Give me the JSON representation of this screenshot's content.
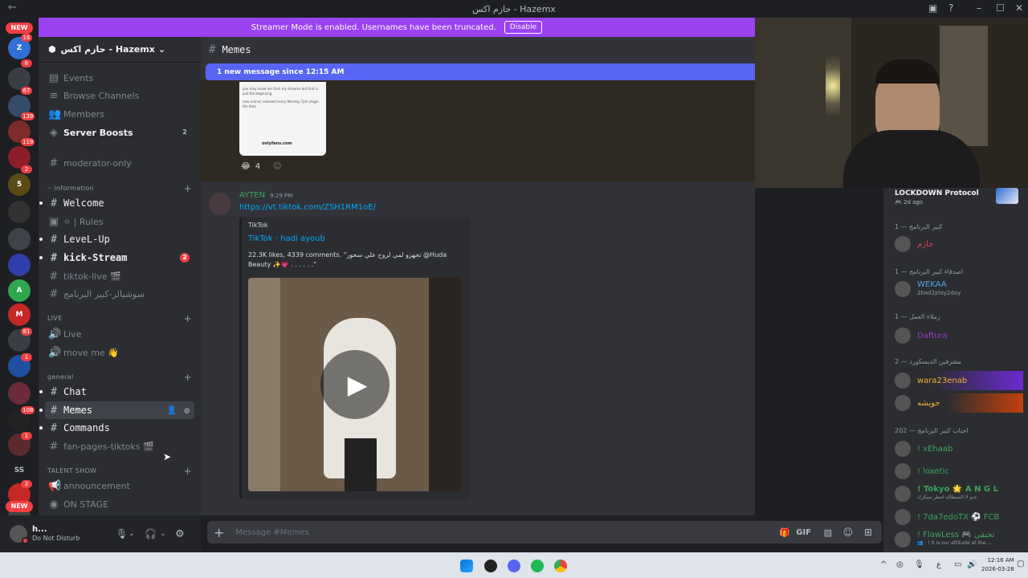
{
  "window": {
    "title": "حازم اكس - Hazemx",
    "controls": [
      "–",
      "☐",
      "✕"
    ]
  },
  "streamer_banner": {
    "text": "Streamer Mode is enabled. Usernames have been truncated.",
    "button": "Disable"
  },
  "guild_bar": {
    "new_top": "NEW",
    "new_bottom": "NEW",
    "badges": [
      "16",
      "6",
      "67",
      "139",
      "119",
      "2",
      "81",
      "1",
      "108",
      "1",
      "2",
      "1"
    ],
    "text_icon": "SS"
  },
  "server": {
    "name": "حازم اكس - Hazemx",
    "chevron": "⌄"
  },
  "sidebar": {
    "top_items": [
      {
        "label": "Events"
      },
      {
        "label": "Browse Channels"
      },
      {
        "label": "Members"
      },
      {
        "label": "Server Boosts",
        "badge": "2"
      }
    ],
    "moderator": "moderator-only",
    "cat_information": "·· information",
    "info_channels": [
      {
        "label": "Welcome"
      },
      {
        "label": "⚪ | Rules"
      },
      {
        "label": "LeveL-Up"
      },
      {
        "label": "kick-Stream",
        "badge": "2"
      },
      {
        "label": "tiktok-live 🎬"
      },
      {
        "label": "سوشيالز-كبير البرنامج"
      }
    ],
    "cat_live": "LIVE",
    "live_channels": [
      {
        "label": "Live"
      },
      {
        "label": "move me 👋"
      }
    ],
    "cat_general": "general",
    "general_channels": [
      {
        "label": "Chat"
      },
      {
        "label": "Memes"
      },
      {
        "label": "Commands"
      },
      {
        "label": "fan-pages-tiktoks 🎬"
      }
    ],
    "cat_talent": "TALENT SHOW",
    "talent_channels": [
      {
        "label": "announcement"
      },
      {
        "label": "ON STAGE"
      }
    ]
  },
  "user_panel": {
    "name": "h...",
    "status": "Do Not Disturb"
  },
  "chat": {
    "channel": "Memes",
    "new_messages": "1 new message since 12:15 AM",
    "meme_lines": [
      "you may know me from my streams but that is",
      "just the beginning",
      "new scenes released every Monday 7pm stage-",
      "the time"
    ],
    "meme_link": "onlyfans.com",
    "reaction_count": "4",
    "message": {
      "author": "AYTEN",
      "time": "9:29 PM",
      "link": "https://vt.tiktok.com/ZSH1RM1oE/",
      "embed_provider": "TikTok",
      "embed_title": "TikTok · hadi ayoub",
      "embed_desc": "22.3K likes, 4339 comments. \"تجهزو لمي لروح علي سحور @Huda Beauty ✨💗 . . . . . .\""
    },
    "input_placeholder": "Message #Memes"
  },
  "members": {
    "stream_card": {
      "title": "LOCKDOWN Protocol",
      "sub": "🎮 2d ago"
    },
    "groups": [
      {
        "label": "كبير البرنامج — 1",
        "users": [
          {
            "name": "حازم",
            "color": "#e0475b"
          }
        ]
      },
      {
        "label": "اصدقاء كبير البرنامج — 1",
        "users": [
          {
            "name": "WEKAA",
            "sub": "2bad2play2day",
            "color": "#4fa3e0"
          }
        ]
      },
      {
        "label": "زملاء العمل — 1",
        "users": [
          {
            "name": "Daftura",
            "color": "#9b3bd1"
          }
        ]
      },
      {
        "label": "مشرفين الديسكورد — 2",
        "users": [
          {
            "name": "wara23enab",
            "color": "#f0b232"
          },
          {
            "name": "حويشه",
            "color": "#f0b232"
          }
        ]
      },
      {
        "label": "احباب كبير البرنامج — 202",
        "users": [
          {
            "name": "! xEhaab",
            "color": "#3ba55d"
          },
          {
            "name": "! loxetic",
            "color": "#3ba55d"
          },
          {
            "name": "! Tokyo 🌟 A N G L",
            "sub": "عدو لا المنتظاله انتظر سيكرك",
            "color": "#3ba55d"
          },
          {
            "name": "! 7da7edoTX ⚽ FCB",
            "color": "#3ba55d"
          },
          {
            "name": "! FlawLess 🎮 تحبقي",
            "sub": "👥 · ! it is our attitude at the ...",
            "color": "#3ba55d"
          }
        ]
      }
    ]
  },
  "taskbar": {
    "time": "12:16 AM",
    "date": "2026-03-28",
    "lang": "ع"
  },
  "colors": {
    "accent": "#5865f2",
    "streamer": "#9b42f3",
    "badge": "#f23f43"
  }
}
